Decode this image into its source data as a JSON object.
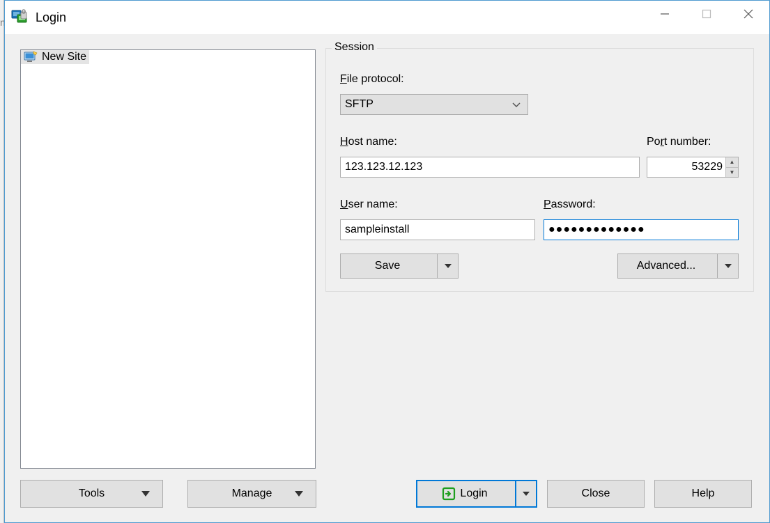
{
  "title": "Login",
  "sites": {
    "new_site_label": "New Site"
  },
  "session": {
    "legend": "Session",
    "file_protocol_label_pre": "F",
    "file_protocol_label_post": "ile protocol:",
    "protocol_value": "SFTP",
    "host_label_pre": "H",
    "host_label_post": "ost name:",
    "host_value": "123.123.12.123",
    "port_label_pre": "Po",
    "port_label_mid": "r",
    "port_label_post": "t number:",
    "port_value": "53229",
    "user_label_pre": "U",
    "user_label_post": "ser name:",
    "user_value": "sampleinstall",
    "pass_label_pre": "P",
    "pass_label_post": "assword:",
    "pass_value": "●●●●●●●●●●●●●",
    "save_label": "Save",
    "advanced_label_pre": "A",
    "advanced_label_mid": "d",
    "advanced_label_post": "vanced..."
  },
  "buttons": {
    "tools": "Tools",
    "manage": "Manage",
    "login": "Login",
    "close": "Close",
    "help": "Help"
  }
}
